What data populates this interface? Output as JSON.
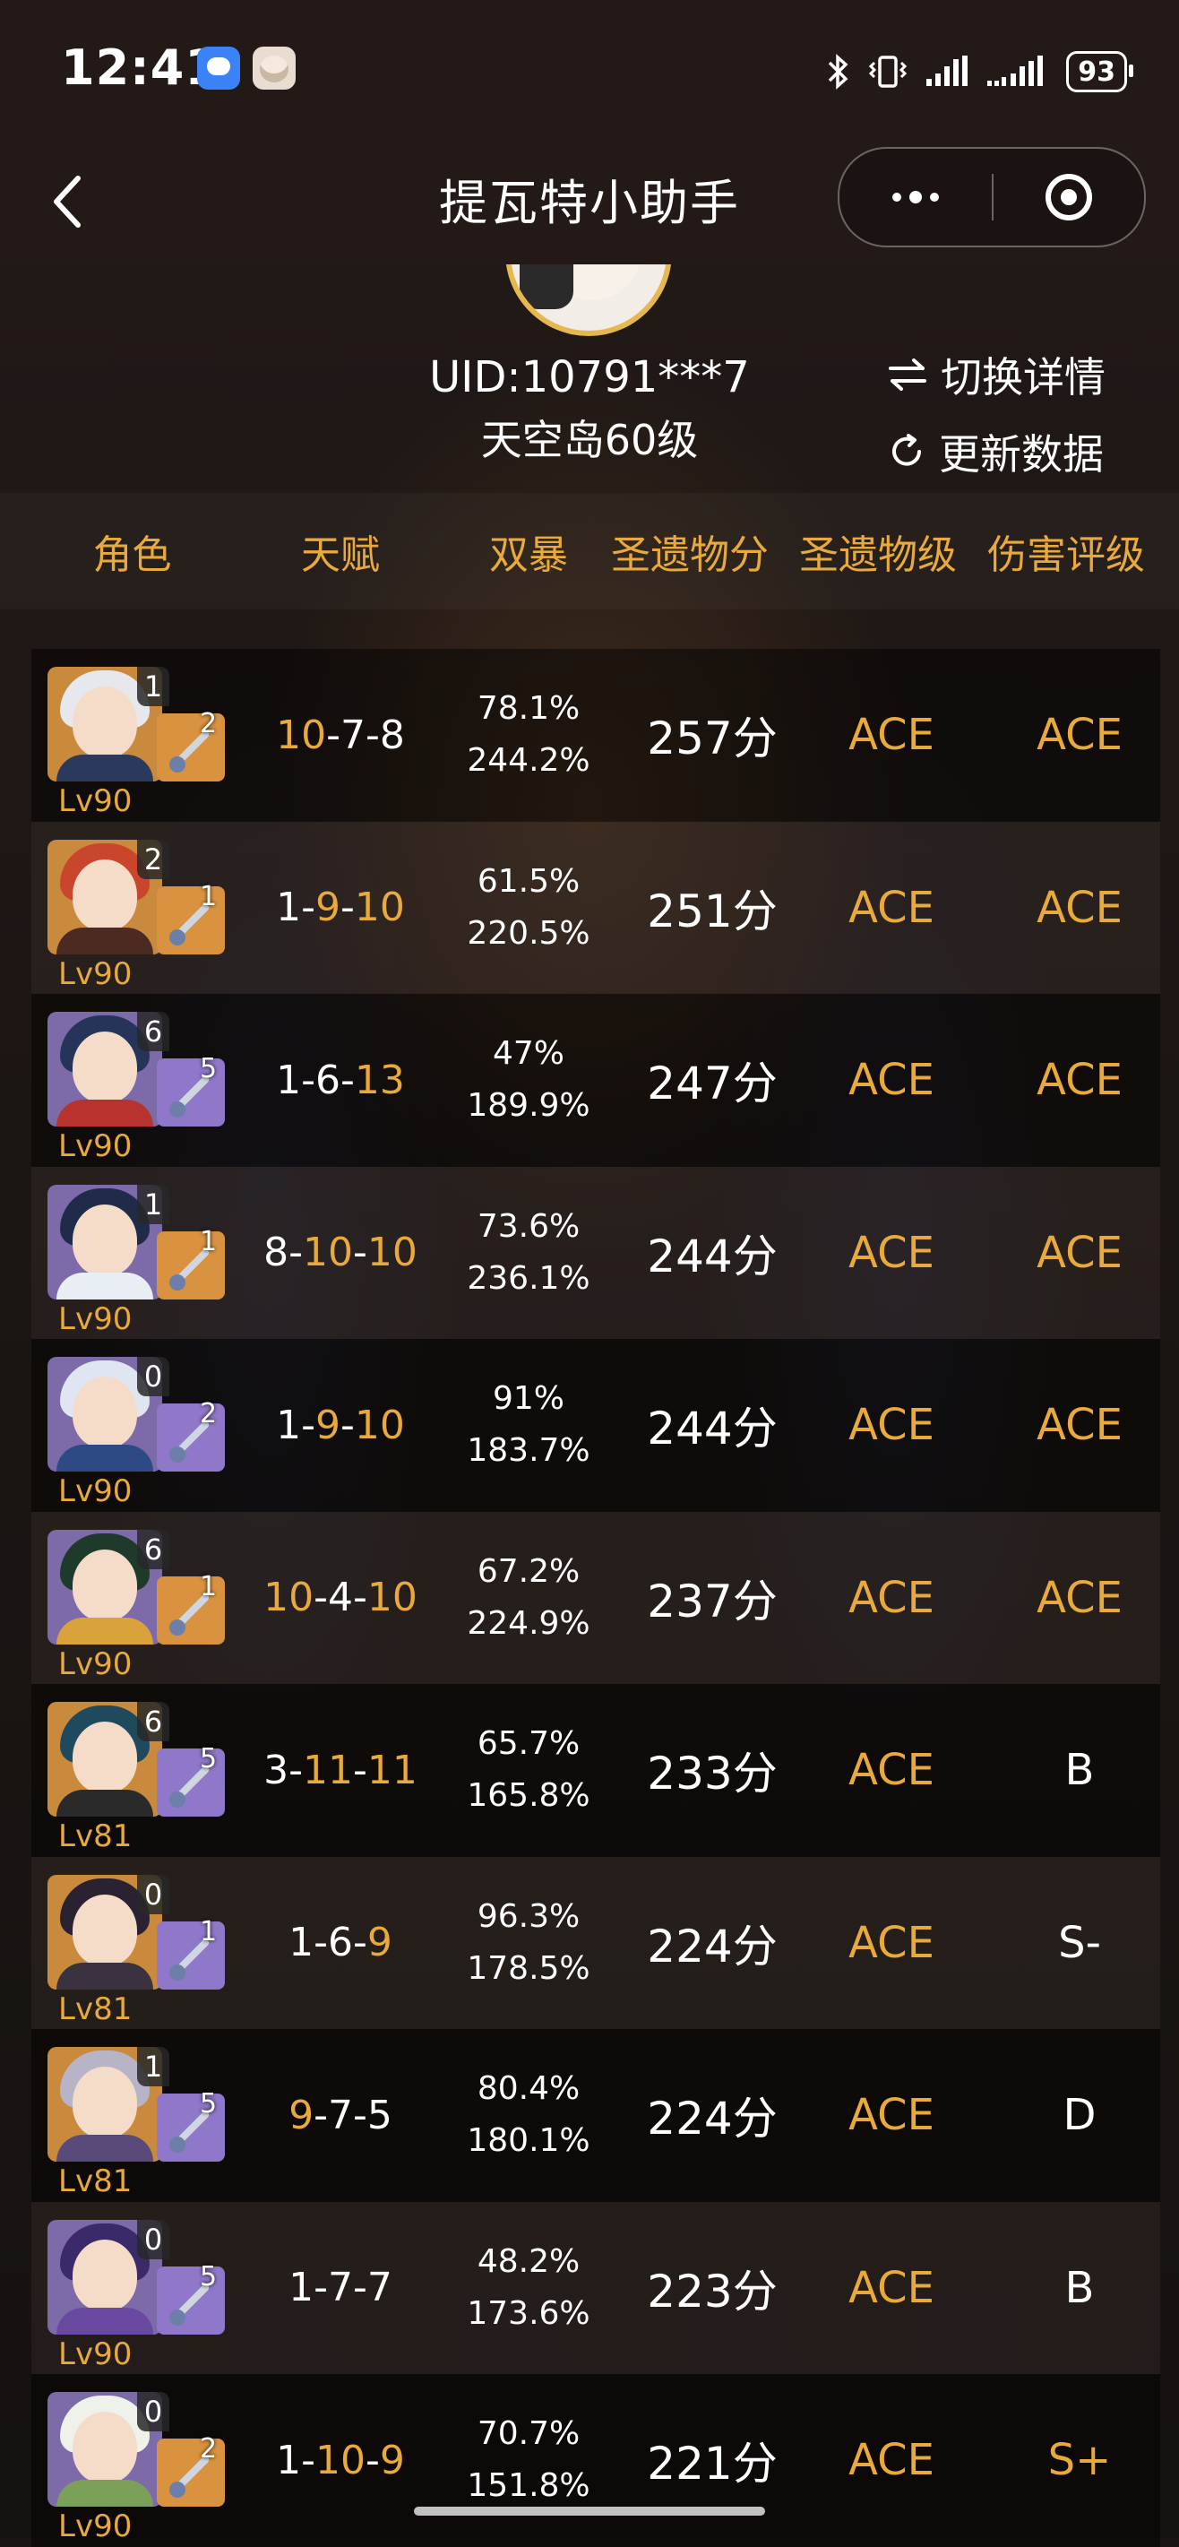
{
  "status_bar": {
    "time": "12:41",
    "battery": "93",
    "icons": [
      "message-app-icon",
      "avatar-app-icon",
      "bluetooth-icon",
      "vibrate-icon",
      "signal-icon",
      "signal-icon",
      "battery-icon"
    ]
  },
  "navbar": {
    "title": "提瓦特小助手",
    "icons": [
      "back-chevron-icon",
      "more-dots-icon",
      "close-target-icon"
    ]
  },
  "profile": {
    "uid": "UID:10791***7",
    "world_level": "天空岛60级",
    "switch_label": "切换详情",
    "refresh_label": "更新数据"
  },
  "table": {
    "headers": [
      "角色",
      "天赋",
      "双暴",
      "圣遗物分",
      "圣遗物级",
      "伤害评级"
    ],
    "rows": [
      {
        "const": "1",
        "refine": "2",
        "level": "Lv90",
        "talents": [
          {
            "v": "10",
            "hl": true
          },
          {
            "v": "7",
            "hl": false
          },
          {
            "v": "8",
            "hl": false
          }
        ],
        "crit_rate": "78.1%",
        "crit_dmg": "244.2%",
        "score": "257分",
        "artifact_grade": "ACE",
        "damage_grade": "ACE",
        "damage_white": false,
        "hair": "#e6e8ee",
        "outfit": "#2b3a5c",
        "weapon_bg": "#d9923f"
      },
      {
        "const": "2",
        "refine": "1",
        "level": "Lv90",
        "talents": [
          {
            "v": "1",
            "hl": false
          },
          {
            "v": "9",
            "hl": true
          },
          {
            "v": "10",
            "hl": true
          }
        ],
        "crit_rate": "61.5%",
        "crit_dmg": "220.5%",
        "score": "251分",
        "artifact_grade": "ACE",
        "damage_grade": "ACE",
        "damage_white": false,
        "hair": "#c9452b",
        "outfit": "#4a2a22",
        "weapon_bg": "#d9923f"
      },
      {
        "const": "6",
        "refine": "5",
        "level": "Lv90",
        "talents": [
          {
            "v": "1",
            "hl": false
          },
          {
            "v": "6",
            "hl": false
          },
          {
            "v": "13",
            "hl": true
          }
        ],
        "crit_rate": "47%",
        "crit_dmg": "189.9%",
        "score": "247分",
        "artifact_grade": "ACE",
        "damage_grade": "ACE",
        "damage_white": false,
        "hair": "#27345a",
        "outfit": "#b8332e",
        "weapon_bg": "#8f77c9"
      },
      {
        "const": "1",
        "refine": "1",
        "level": "Lv90",
        "talents": [
          {
            "v": "8",
            "hl": false
          },
          {
            "v": "10",
            "hl": true
          },
          {
            "v": "10",
            "hl": true
          }
        ],
        "crit_rate": "73.6%",
        "crit_dmg": "236.1%",
        "score": "244分",
        "artifact_grade": "ACE",
        "damage_grade": "ACE",
        "damage_white": false,
        "hair": "#1f2b48",
        "outfit": "#e9edf4",
        "weapon_bg": "#d9923f"
      },
      {
        "const": "0",
        "refine": "2",
        "level": "Lv90",
        "talents": [
          {
            "v": "1",
            "hl": false
          },
          {
            "v": "9",
            "hl": true
          },
          {
            "v": "10",
            "hl": true
          }
        ],
        "crit_rate": "91%",
        "crit_dmg": "183.7%",
        "score": "244分",
        "artifact_grade": "ACE",
        "damage_grade": "ACE",
        "damage_white": false,
        "hair": "#dfe6f2",
        "outfit": "#2d4a86",
        "weapon_bg": "#8f77c9"
      },
      {
        "const": "6",
        "refine": "1",
        "level": "Lv90",
        "talents": [
          {
            "v": "10",
            "hl": true
          },
          {
            "v": "4",
            "hl": false
          },
          {
            "v": "10",
            "hl": true
          }
        ],
        "crit_rate": "67.2%",
        "crit_dmg": "224.9%",
        "score": "237分",
        "artifact_grade": "ACE",
        "damage_grade": "ACE",
        "damage_white": false,
        "hair": "#1e3a2a",
        "outfit": "#d9a23a",
        "weapon_bg": "#d9923f"
      },
      {
        "const": "6",
        "refine": "5",
        "level": "Lv81",
        "talents": [
          {
            "v": "3",
            "hl": false
          },
          {
            "v": "11",
            "hl": true
          },
          {
            "v": "11",
            "hl": true
          }
        ],
        "crit_rate": "65.7%",
        "crit_dmg": "165.8%",
        "score": "233分",
        "artifact_grade": "ACE",
        "damage_grade": "B",
        "damage_white": true,
        "hair": "#1f4a5e",
        "outfit": "#2a2a2a",
        "weapon_bg": "#8f77c9"
      },
      {
        "const": "0",
        "refine": "1",
        "level": "Lv81",
        "talents": [
          {
            "v": "1",
            "hl": false
          },
          {
            "v": "6",
            "hl": false
          },
          {
            "v": "9",
            "hl": true
          }
        ],
        "crit_rate": "96.3%",
        "crit_dmg": "178.5%",
        "score": "224分",
        "artifact_grade": "ACE",
        "damage_grade": "S-",
        "damage_white": true,
        "hair": "#2a2230",
        "outfit": "#3b3240",
        "weapon_bg": "#8f77c9"
      },
      {
        "const": "1",
        "refine": "5",
        "level": "Lv81",
        "talents": [
          {
            "v": "9",
            "hl": true
          },
          {
            "v": "7",
            "hl": false
          },
          {
            "v": "5",
            "hl": false
          }
        ],
        "crit_rate": "80.4%",
        "crit_dmg": "180.1%",
        "score": "224分",
        "artifact_grade": "ACE",
        "damage_grade": "D",
        "damage_white": true,
        "hair": "#b8b4c8",
        "outfit": "#5a4a7a",
        "weapon_bg": "#8f77c9"
      },
      {
        "const": "0",
        "refine": "5",
        "level": "Lv90",
        "talents": [
          {
            "v": "1",
            "hl": false
          },
          {
            "v": "7",
            "hl": false
          },
          {
            "v": "7",
            "hl": false
          }
        ],
        "crit_rate": "48.2%",
        "crit_dmg": "173.6%",
        "score": "223分",
        "artifact_grade": "ACE",
        "damage_grade": "B",
        "damage_white": true,
        "hair": "#3a2a6a",
        "outfit": "#6a4aa0",
        "weapon_bg": "#8f77c9"
      },
      {
        "const": "0",
        "refine": "2",
        "level": "Lv90",
        "talents": [
          {
            "v": "1",
            "hl": false
          },
          {
            "v": "10",
            "hl": true
          },
          {
            "v": "9",
            "hl": true
          }
        ],
        "crit_rate": "70.7%",
        "crit_dmg": "151.8%",
        "score": "221分",
        "artifact_grade": "ACE",
        "damage_grade": "S+",
        "damage_white": false,
        "hair": "#eef2ea",
        "outfit": "#7aa05a",
        "weapon_bg": "#d9923f"
      }
    ]
  },
  "colors": {
    "accent": "#e8a93d",
    "background": "#1a1412",
    "avatar_gold_bg": "#c98a3e",
    "avatar_purple_bg": "#7d6aa8"
  }
}
